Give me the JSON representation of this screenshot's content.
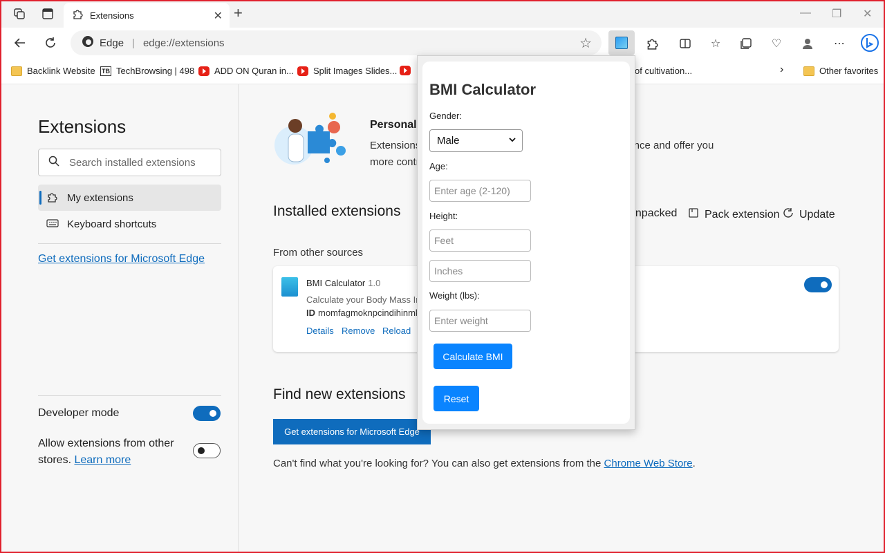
{
  "browser": {
    "tab": {
      "title": "Extensions"
    },
    "address": {
      "site": "Edge",
      "url": "edge://extensions"
    },
    "favorites": [
      {
        "label": "Backlink Website",
        "icon": "folder-icon"
      },
      {
        "label": "TechBrowsing | 498",
        "icon": "techbrowsing-icon"
      },
      {
        "label": "ADD ON Quran in...",
        "icon": "youtube-icon"
      },
      {
        "label": "Split Images Slides...",
        "icon": "youtube-icon"
      },
      {
        "label": "of cultivation...",
        "icon": ""
      }
    ],
    "other_favorites": "Other favorites"
  },
  "sidebar": {
    "title": "Extensions",
    "search_placeholder": "Search installed extensions",
    "items": [
      {
        "label": "My extensions"
      },
      {
        "label": "Keyboard shortcuts"
      }
    ],
    "get_link": "Get extensions for Microsoft Edge",
    "developer_mode": "Developer mode",
    "allow_label": "Allow extensions from other stores.",
    "learn_more": "Learn more"
  },
  "main": {
    "hero_title": "Personali",
    "hero_line1": "Extensions",
    "hero_line1b": "ience and offer you",
    "hero_line2": "more contr",
    "installed_title": "Installed extensions",
    "actions": {
      "load_unpacked": "unpacked",
      "pack": "Pack extension",
      "update": "Update"
    },
    "from_other_sources": "From other sources",
    "extension": {
      "name": "BMI Calculator",
      "version": "1.0",
      "description": "Calculate your Body Mass Inde",
      "id_label": "ID",
      "id": "momfagmoknpcindihinmkb",
      "links": [
        "Details",
        "Remove",
        "Reload"
      ]
    },
    "find_title": "Find new extensions",
    "get_button": "Get extensions for Microsoft Edge",
    "cant_find": "Can't find what you're looking for? You can also get extensions from the",
    "chrome_store": "Chrome Web Store",
    "period": "."
  },
  "popup": {
    "title": "BMI Calculator",
    "gender_label": "Gender:",
    "gender_value": "Male",
    "age_label": "Age:",
    "age_placeholder": "Enter age (2-120)",
    "height_label": "Height:",
    "feet_placeholder": "Feet",
    "inches_placeholder": "Inches",
    "weight_label": "Weight (lbs):",
    "weight_placeholder": "Enter weight",
    "calculate_button": "Calculate BMI",
    "reset_button": "Reset"
  },
  "colors": {
    "accent": "#0f6cbd",
    "popup_button": "#0a84ff",
    "frame": "#e0212e"
  }
}
